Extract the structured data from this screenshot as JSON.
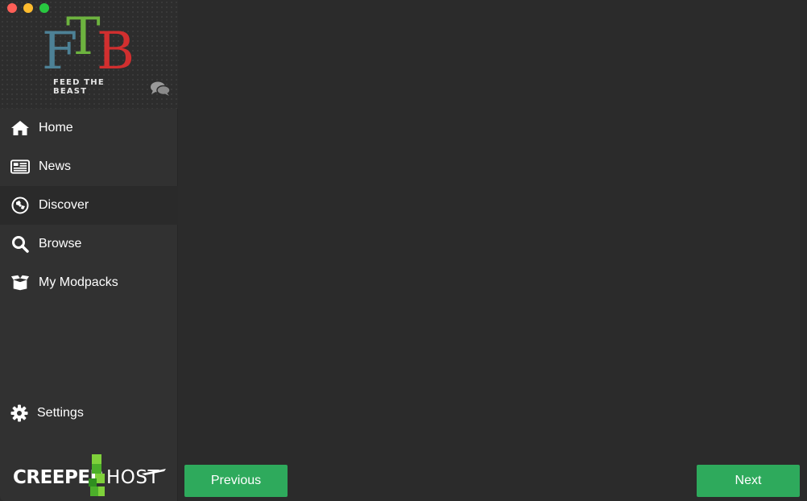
{
  "window": {
    "controls": [
      "close",
      "minimize",
      "zoom"
    ]
  },
  "logo": {
    "letters": [
      "F",
      "T",
      "B"
    ],
    "tagline": "FEED THE BEAST",
    "colors": {
      "f": "#4d8196",
      "t": "#6db33f",
      "b": "#d12f2f"
    }
  },
  "sidebar": {
    "items": [
      {
        "label": "Home",
        "icon": "home-icon",
        "active": false
      },
      {
        "label": "News",
        "icon": "newspaper-icon",
        "active": false
      },
      {
        "label": "Discover",
        "icon": "compass-icon",
        "active": true
      },
      {
        "label": "Browse",
        "icon": "search-icon",
        "active": false
      },
      {
        "label": "My Modpacks",
        "icon": "box-icon",
        "active": false
      }
    ],
    "settings": {
      "label": "Settings",
      "icon": "gear-icon"
    }
  },
  "sponsor": {
    "text_left": "CREEPER",
    "text_right": "HOST"
  },
  "footer": {
    "previous_label": "Previous",
    "next_label": "Next",
    "accent": "#2eaa5c"
  }
}
